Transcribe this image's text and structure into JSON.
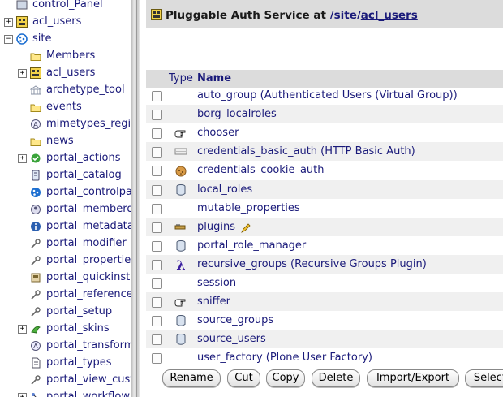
{
  "tree": {
    "items": [
      {
        "label": "control_Panel",
        "toggle": "",
        "icon": "control-panel-icon"
      },
      {
        "label": "acl_users",
        "toggle": "+",
        "icon": "acl-users-icon"
      },
      {
        "label": "site",
        "toggle": "−",
        "icon": "plone-site-icon"
      },
      {
        "label": "Members",
        "toggle": "",
        "icon": "folder-icon"
      },
      {
        "label": "acl_users",
        "toggle": "+",
        "icon": "acl-users-icon"
      },
      {
        "label": "archetype_tool",
        "toggle": "",
        "icon": "archetype-tool-icon"
      },
      {
        "label": "events",
        "toggle": "",
        "icon": "folder-icon"
      },
      {
        "label": "mimetypes_registry",
        "toggle": "",
        "icon": "mimetypes-icon"
      },
      {
        "label": "news",
        "toggle": "",
        "icon": "folder-icon"
      },
      {
        "label": "portal_actions",
        "toggle": "+",
        "icon": "portal-actions-icon"
      },
      {
        "label": "portal_catalog",
        "toggle": "",
        "icon": "catalog-icon"
      },
      {
        "label": "portal_controlpanel",
        "toggle": "",
        "icon": "controlpanel-icon"
      },
      {
        "label": "portal_memberdata",
        "toggle": "",
        "icon": "memberdata-icon"
      },
      {
        "label": "portal_metadata",
        "toggle": "",
        "icon": "info-icon"
      },
      {
        "label": "portal_modifier",
        "toggle": "",
        "icon": "wrench-icon"
      },
      {
        "label": "portal_properties",
        "toggle": "",
        "icon": "wrench-icon"
      },
      {
        "label": "portal_quickinstaller",
        "toggle": "",
        "icon": "quickinstaller-icon"
      },
      {
        "label": "portal_reference_catalog",
        "toggle": "",
        "icon": "wrench-icon"
      },
      {
        "label": "portal_setup",
        "toggle": "",
        "icon": "wrench-icon"
      },
      {
        "label": "portal_skins",
        "toggle": "+",
        "icon": "skins-icon"
      },
      {
        "label": "portal_transforms",
        "toggle": "",
        "icon": "transforms-icon"
      },
      {
        "label": "portal_types",
        "toggle": "",
        "icon": "document-icon"
      },
      {
        "label": "portal_view_customizations",
        "toggle": "",
        "icon": "wrench-icon"
      },
      {
        "label": "portal_workflow",
        "toggle": "+",
        "icon": "workflow-icon"
      }
    ]
  },
  "header": {
    "title_prefix": "Pluggable Auth Service at ",
    "path": "/site/",
    "link": "acl_users"
  },
  "table": {
    "type_header": "Type",
    "name_header": "Name",
    "rows": [
      {
        "name": "auto_group (Authenticated Users (Virtual Group))",
        "icon": ""
      },
      {
        "name": "borg_localroles",
        "icon": ""
      },
      {
        "name": "chooser",
        "icon": "pointing-hand-icon"
      },
      {
        "name": "credentials_basic_auth (HTTP Basic Auth)",
        "icon": "basic-auth-icon"
      },
      {
        "name": "credentials_cookie_auth",
        "icon": "cookie-icon"
      },
      {
        "name": "local_roles",
        "icon": "database-icon"
      },
      {
        "name": "mutable_properties",
        "icon": ""
      },
      {
        "name": "plugins",
        "icon": "plugins-icon"
      },
      {
        "name": "portal_role_manager",
        "icon": "database-icon"
      },
      {
        "name": "recursive_groups (Recursive Groups Plugin)",
        "icon": "lambda-icon"
      },
      {
        "name": "session",
        "icon": ""
      },
      {
        "name": "sniffer",
        "icon": "pointing-hand-icon"
      },
      {
        "name": "source_groups",
        "icon": "database-icon"
      },
      {
        "name": "source_users",
        "icon": "database-icon"
      },
      {
        "name": "user_factory (Plone User Factory)",
        "icon": ""
      }
    ]
  },
  "buttons": {
    "rename": "Rename",
    "cut": "Cut",
    "copy": "Copy",
    "delete": "Delete",
    "import_export": "Import/Export",
    "select_all": "Select All"
  }
}
